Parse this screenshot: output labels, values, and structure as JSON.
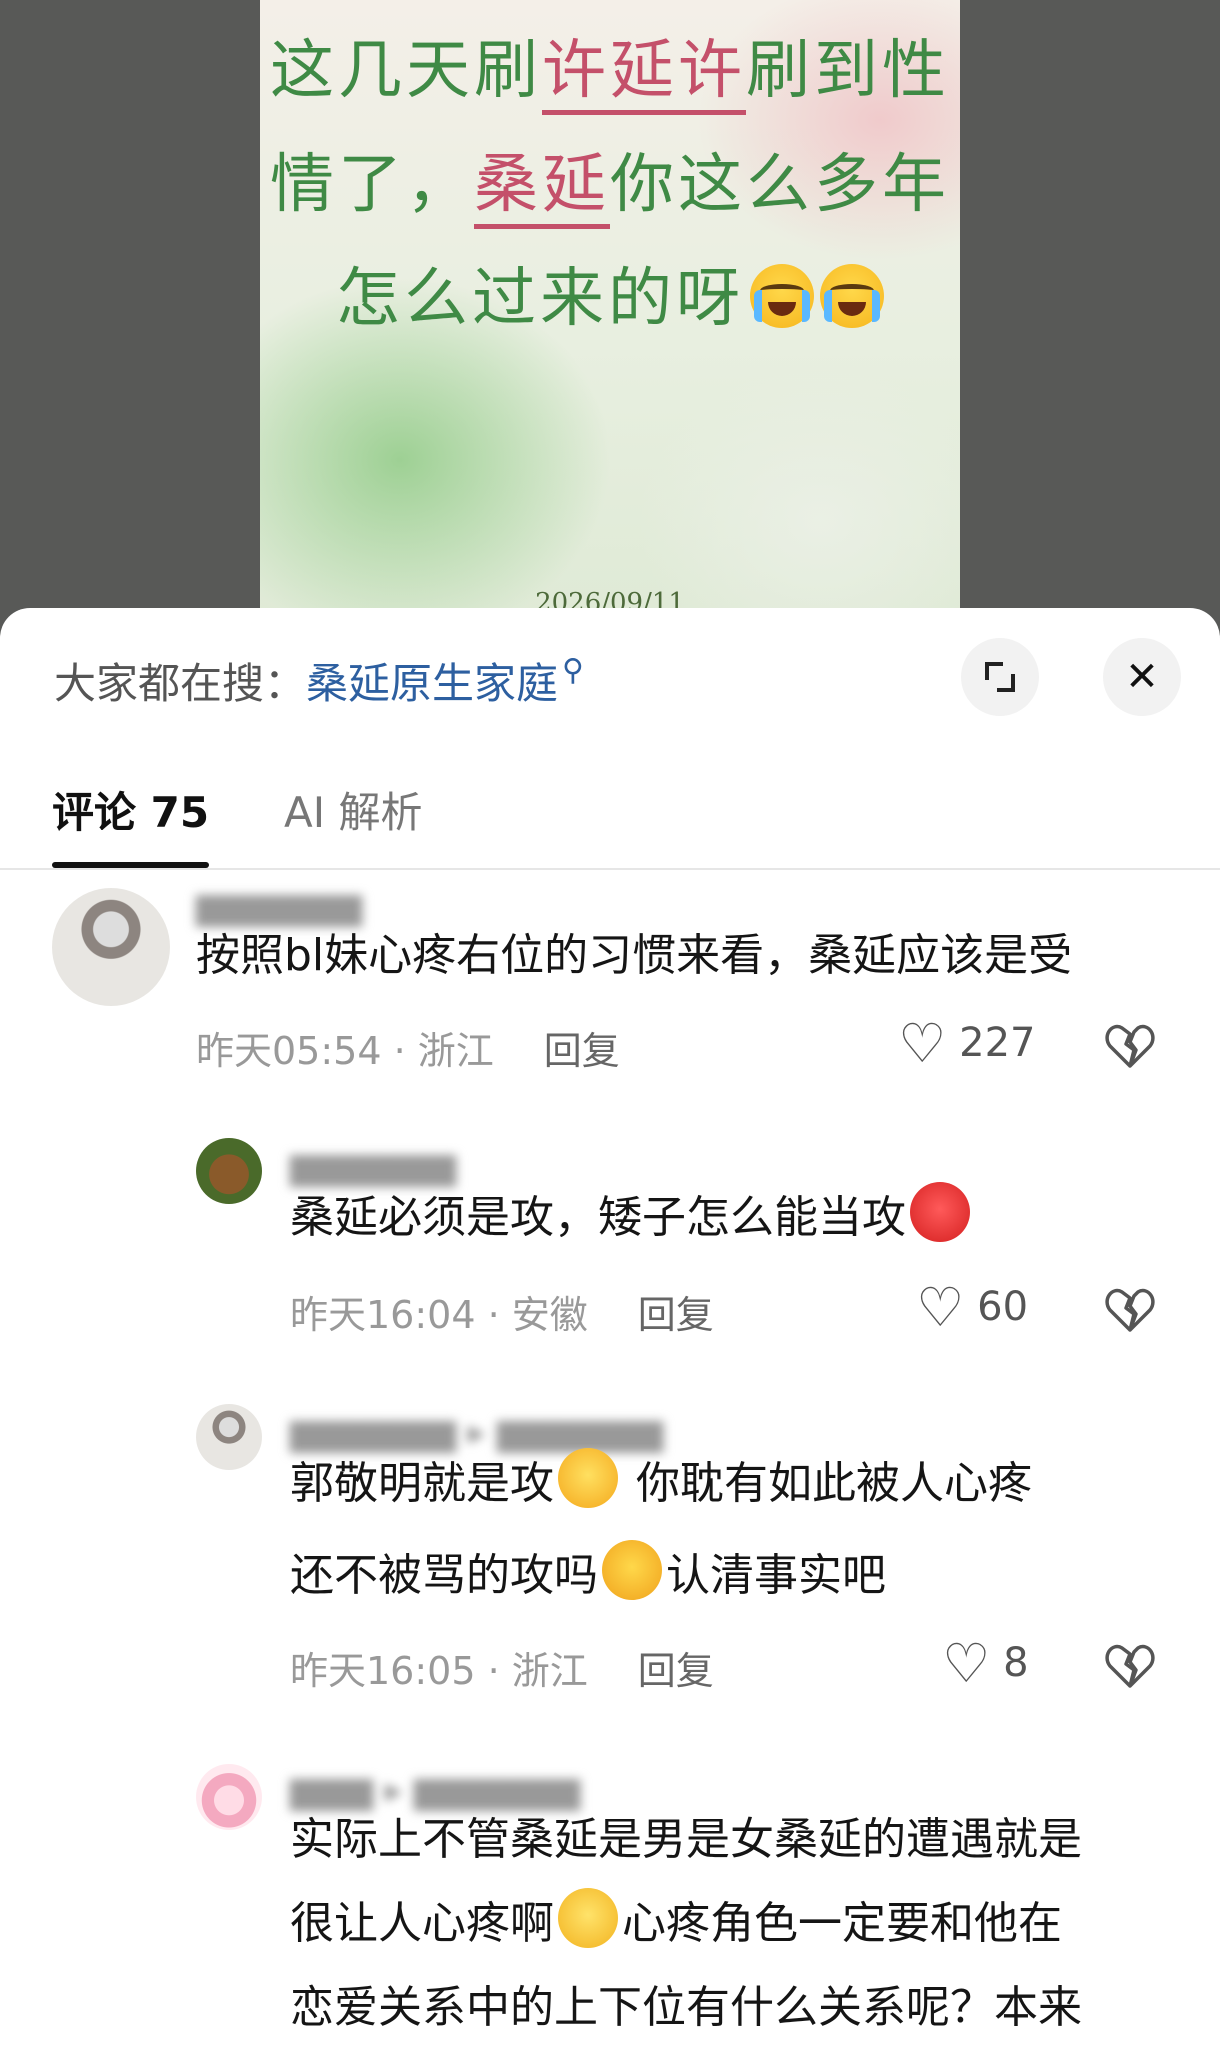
{
  "post": {
    "line1_a": "这几天刷",
    "line1_hl": "许延许",
    "line1_b": "刷到性",
    "line2_a": "情了，",
    "line2_hl": "桑延",
    "line2_b": "你这么多年",
    "line3": "怎么过来的呀",
    "date": "2026/09/11"
  },
  "header": {
    "search_prefix": "大家都在搜：",
    "search_term": "桑延原生家庭",
    "search_icon": "magnifier-icon",
    "close_label": "✕"
  },
  "tabs": [
    {
      "label": "评论 75",
      "active": true
    },
    {
      "label": "AI 解析",
      "active": false
    }
  ],
  "comments": [
    {
      "text": "按照bl妹心疼右位的习惯来看，桑延应该是受",
      "time": "昨天05:54 · 浙江",
      "reply": "回复",
      "likes": "227"
    },
    {
      "text": "桑延必须是攻，矮子怎么能当攻",
      "time": "昨天16:04 · 安徽",
      "reply": "回复",
      "likes": "60"
    },
    {
      "text_a": "郭敬明就是攻",
      "text_b": " 你耽有如此被人心疼",
      "text_c": "还不被骂的攻吗",
      "text_d": "认清事实吧",
      "time": "昨天16:05 · 浙江",
      "reply": "回复",
      "likes": "8"
    },
    {
      "line1": "实际上不管桑延是男是女桑延的遭遇就是",
      "line2_a": "很让人心疼啊",
      "line2_b": "心疼角色一定要和他在",
      "line3": "恋爱关系中的上下位有什么关系呢？本来"
    }
  ],
  "colors": {
    "accent_link": "#2d5fa0",
    "post_text": "#3f8a45",
    "post_highlight": "#c4506a"
  }
}
